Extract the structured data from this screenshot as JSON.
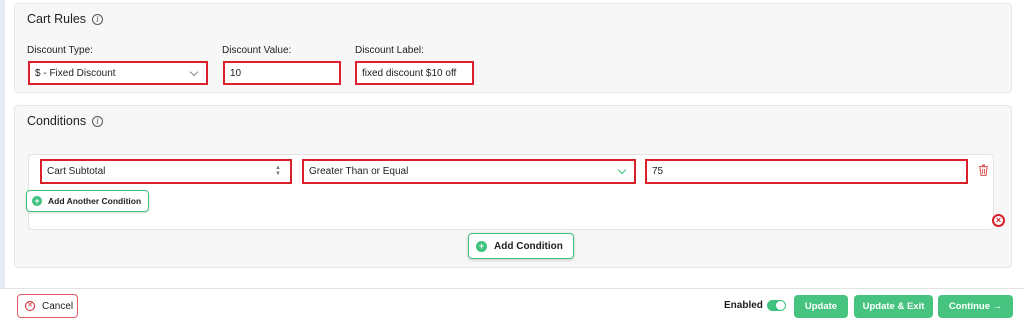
{
  "cart_rules": {
    "title": "Cart Rules",
    "discount_type": {
      "label": "Discount Type:",
      "value": "$ - Fixed Discount"
    },
    "discount_value": {
      "label": "Discount Value:",
      "value": "10"
    },
    "discount_label": {
      "label": "Discount Label:",
      "value": "fixed discount $10 off"
    }
  },
  "conditions": {
    "title": "Conditions",
    "condition_type": "Cart Subtotal",
    "operator": "Greater Than or Equal",
    "value": "75",
    "add_another_label": "Add Another Condition",
    "add_condition_label": "Add Condition"
  },
  "footer": {
    "cancel_label": "Cancel",
    "enabled_label": "Enabled",
    "enabled": true,
    "update_label": "Update",
    "update_exit_label": "Update & Exit",
    "continue_label": "Continue →"
  },
  "colors": {
    "accent_green": "#46c47f",
    "highlight_red": "#d9202b"
  }
}
